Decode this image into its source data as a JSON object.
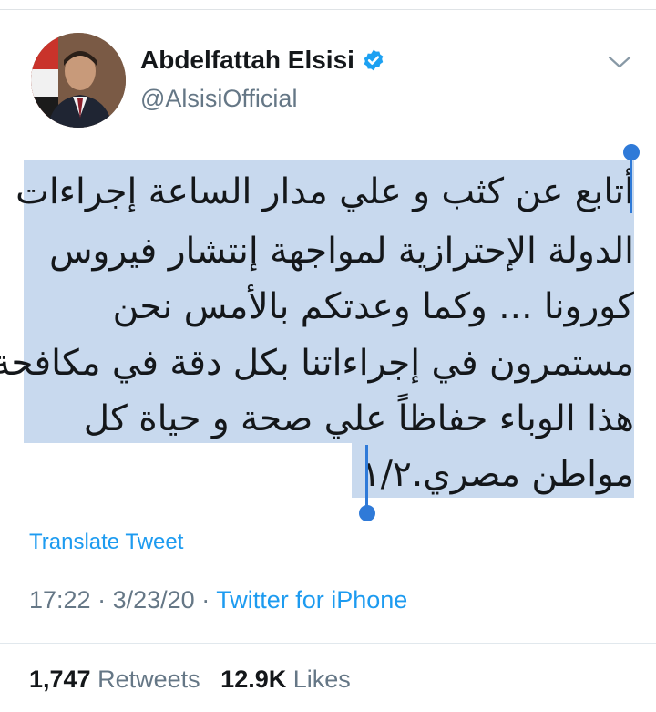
{
  "user": {
    "display_name": "Abdelfattah Elsisi",
    "handle": "@AlsisiOfficial",
    "verified": true,
    "avatar_icon": "profile-photo"
  },
  "tweet": {
    "lines": [
      "أتابع عن كثب و علي مدار الساعة إجراءات",
      "الدولة الإحترازية لمواجهة إنتشار فيروس",
      "كورونا ... وكما وعدتكم بالأمس نحن",
      "مستمرون في إجراءاتنا بكل دقة في مكافحة",
      "هذا الوباء حفاظاً علي صحة و حياة كل",
      "مواطن مصري.١/٢"
    ],
    "translate_label": "Translate Tweet",
    "time": "17:22",
    "date": "3/23/20",
    "source": "Twitter for iPhone",
    "separator": "·"
  },
  "stats": {
    "retweets_count": "1,747",
    "retweets_label": "Retweets",
    "likes_count": "12.9K",
    "likes_label": "Likes"
  },
  "colors": {
    "link": "#1d9bf0",
    "secondary_text": "#657786",
    "selection": "#c8d9ee",
    "selection_handle": "#2f7ad8",
    "verified_badge": "#1da1f2"
  }
}
